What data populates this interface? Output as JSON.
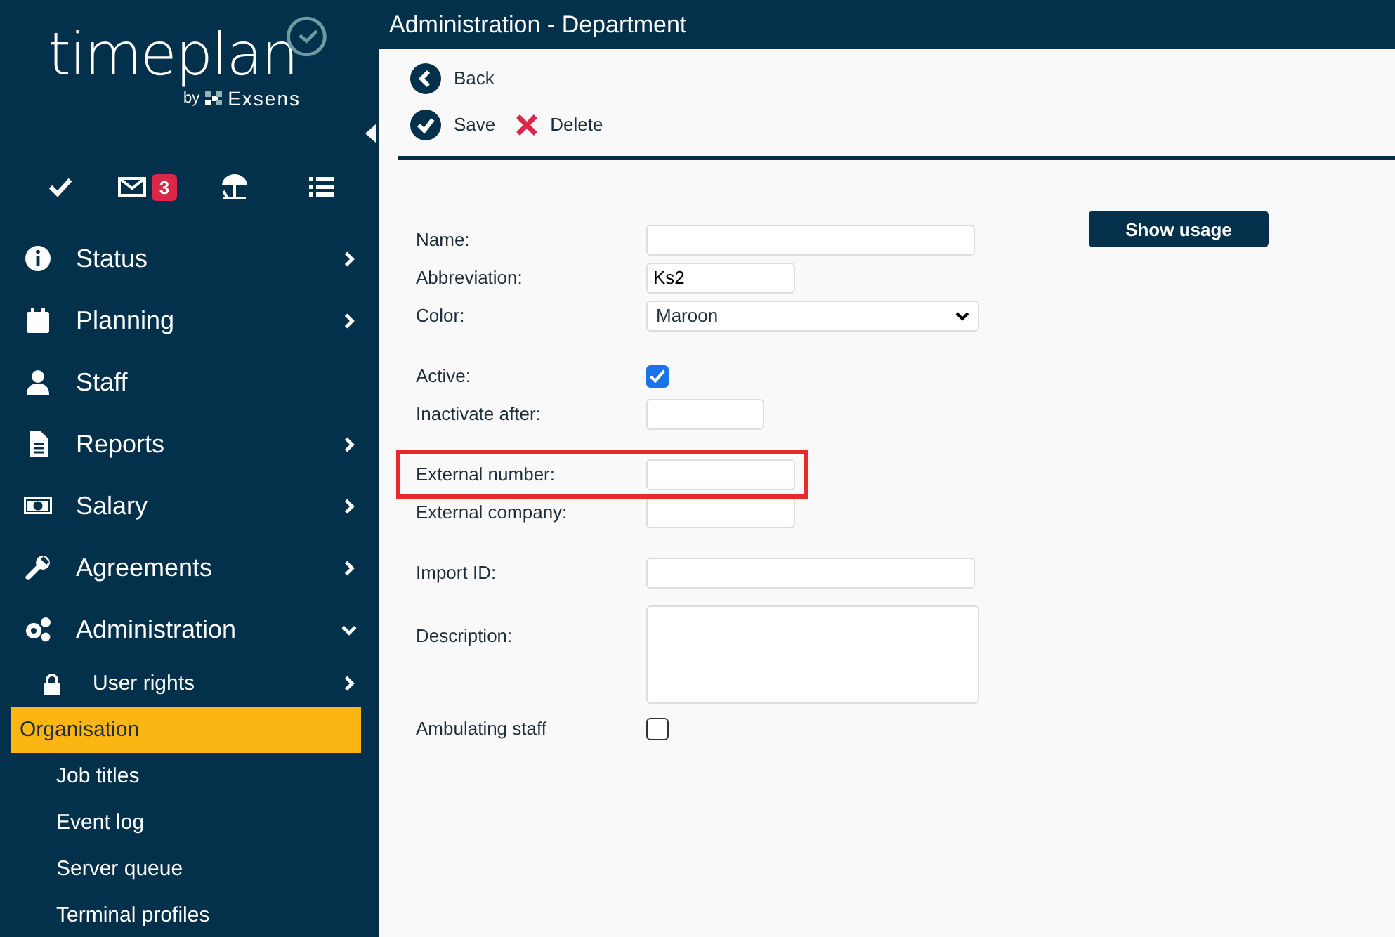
{
  "logo": {
    "name": "timeplan",
    "byline": "by",
    "brand": "Exsens"
  },
  "quick_icons": [
    {
      "kind": "check"
    },
    {
      "kind": "mail",
      "badge": "3"
    },
    {
      "kind": "umbrella"
    },
    {
      "kind": "list"
    }
  ],
  "menu": [
    {
      "label": "Status",
      "has_submenu": true,
      "expanded": false
    },
    {
      "label": "Planning",
      "has_submenu": true,
      "expanded": false
    },
    {
      "label": "Staff",
      "has_submenu": false
    },
    {
      "label": "Reports",
      "has_submenu": true,
      "expanded": false
    },
    {
      "label": "Salary",
      "has_submenu": true,
      "expanded": false
    },
    {
      "label": "Agreements",
      "has_submenu": true,
      "expanded": false
    },
    {
      "label": "Administration",
      "has_submenu": true,
      "expanded": true,
      "children": [
        {
          "label": "User rights",
          "has_submenu": true,
          "selected": false
        },
        {
          "label": "Organisation",
          "has_submenu": false,
          "selected": true
        },
        {
          "label": "Job titles",
          "has_submenu": false,
          "selected": false
        },
        {
          "label": "Event log",
          "has_submenu": false,
          "selected": false
        },
        {
          "label": "Server queue",
          "has_submenu": false,
          "selected": false
        },
        {
          "label": "Terminal profiles",
          "has_submenu": false,
          "selected": false
        }
      ]
    }
  ],
  "header": {
    "title": "Administration - Department"
  },
  "toolbar": {
    "back": "Back",
    "save": "Save",
    "delete": "Delete"
  },
  "show_usage": "Show usage",
  "form_groups": [
    [
      {
        "label": "Name:",
        "kind": "long"
      },
      {
        "label": "Abbreviation:",
        "kind": "short",
        "value": "Ks2"
      },
      {
        "label": "Color:",
        "kind": "select",
        "value": "Maroon"
      }
    ],
    [
      {
        "label": "Active:",
        "kind": "checkbox",
        "checked": true
      },
      {
        "label": "Inactivate after:",
        "kind": "date"
      }
    ],
    [
      {
        "label": "External number:",
        "kind": "short",
        "highlighted": true
      },
      {
        "label": "External company:",
        "kind": "short",
        "highlighted": false
      }
    ],
    [
      {
        "label": "Import ID:",
        "kind": "long"
      }
    ],
    [
      {
        "label": "Description:",
        "kind": "textarea"
      }
    ],
    [
      {
        "label": "Ambulating staff",
        "kind": "checkbox",
        "checked": false
      }
    ]
  ]
}
